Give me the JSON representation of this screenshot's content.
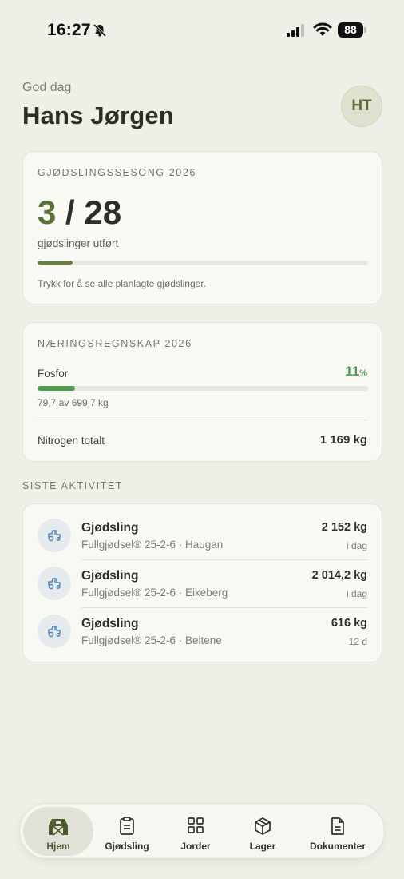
{
  "status_bar": {
    "time": "16:27",
    "battery": "88"
  },
  "header": {
    "greeting": "God dag",
    "name": "Hans Jørgen",
    "avatar_initials": "HT"
  },
  "season_card": {
    "title": "GJØDSLINGSSESONG 2026",
    "done": "3",
    "separator": "/",
    "total": "28",
    "subtitle": "gjødslinger utført",
    "progress_fraction": 0.107,
    "hint": "Trykk for å se alle planlagte gjødslinger."
  },
  "nutrient_card": {
    "title": "NÆRINGSREGNSKAP 2026",
    "fosfor": {
      "label": "Fosfor",
      "percent": "11",
      "percent_sign": "%",
      "detail": "79,7 av 699,7 kg",
      "progress_fraction": 0.114
    },
    "nitrogen": {
      "label": "Nitrogen totalt",
      "value": "1 169 kg"
    }
  },
  "activity": {
    "section_title": "SISTE AKTIVITET",
    "items": [
      {
        "title": "Gjødsling",
        "subtitle": "Fullgjødsel® 25-2-6 · Haugan",
        "amount": "2 152 kg",
        "when": "i dag",
        "icon": "tractor-icon"
      },
      {
        "title": "Gjødsling",
        "subtitle": "Fullgjødsel® 25-2-6 · Eikeberg",
        "amount": "2 014,2 kg",
        "when": "i dag",
        "icon": "tractor-icon"
      },
      {
        "title": "Gjødsling",
        "subtitle": "Fullgjødsel® 25-2-6 · Beitene",
        "amount": "616 kg",
        "when": "12 d",
        "icon": "tractor-icon"
      }
    ]
  },
  "nav": {
    "items": [
      {
        "label": "Hjem",
        "icon": "barn-icon",
        "active": true
      },
      {
        "label": "Gjødsling",
        "icon": "clipboard-icon",
        "active": false
      },
      {
        "label": "Jorder",
        "icon": "grid-icon",
        "active": false
      },
      {
        "label": "Lager",
        "icon": "box-icon",
        "active": false
      },
      {
        "label": "Dokumenter",
        "icon": "document-icon",
        "active": false
      }
    ]
  },
  "colors": {
    "accent_olive": "#5b7137",
    "progress_green": "#4e9a4e",
    "background": "#f0efe7"
  }
}
